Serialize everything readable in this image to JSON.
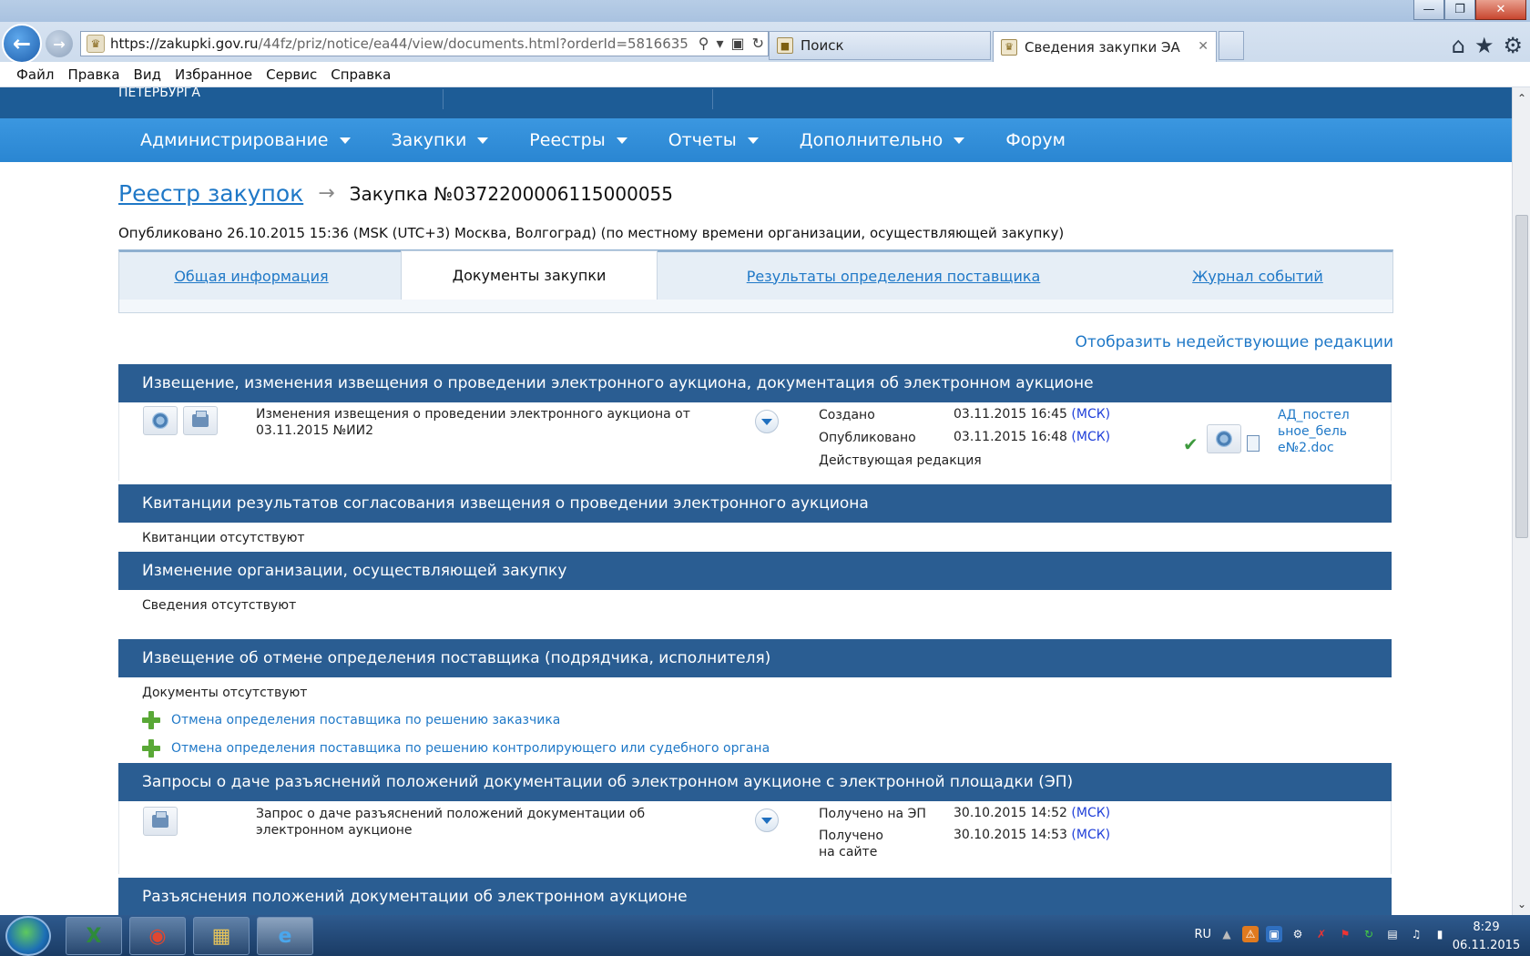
{
  "browser": {
    "url_host": "https://zakupki.gov.ru",
    "url_path": "/44fz/priz/notice/ea44/view/documents.html?orderId=5816635",
    "tabs": [
      {
        "label": "Поиск"
      },
      {
        "label": "Сведения закупки ЭА"
      }
    ],
    "menu": [
      "Файл",
      "Правка",
      "Вид",
      "Избранное",
      "Сервис",
      "Справка"
    ]
  },
  "site": {
    "org_line": "ПЕТЕРБУРГА",
    "nav": [
      {
        "label": "Администрирование",
        "has_dropdown": true
      },
      {
        "label": "Закупки",
        "has_dropdown": true
      },
      {
        "label": "Реестры",
        "has_dropdown": true
      },
      {
        "label": "Отчеты",
        "has_dropdown": true
      },
      {
        "label": "Дополнительно",
        "has_dropdown": true
      },
      {
        "label": "Форум",
        "has_dropdown": false
      }
    ]
  },
  "breadcrumb": {
    "registry_link": "Реестр закупок",
    "current": "Закупка №0372200006115000055"
  },
  "published_line": "Опубликовано 26.10.2015 15:36 (MSK (UTC+3) Москва, Волгоград) (по местному времени организации, осуществляющей закупку)",
  "tabs": [
    {
      "label": "Общая информация",
      "active": false
    },
    {
      "label": "Документы закупки",
      "active": true
    },
    {
      "label": "Результаты определения поставщика",
      "active": false
    },
    {
      "label": "Журнал событий",
      "active": false
    }
  ],
  "show_inactive_link": "Отобразить недействующие редакции",
  "sections": {
    "notice": {
      "title": "Извещение, изменения извещения о проведении электронного аукциона, документация об электронном аукционе",
      "doc_title": "Изменения извещения о проведении электронного аукциона от 03.11.2015 №ИИ2",
      "created_label": "Создано",
      "created_value": "03.11.2015 16:45",
      "published_label": "Опубликовано",
      "published_value": "03.11.2015 16:48",
      "tz": "(МСК)",
      "status": "Действующая редакция",
      "file_name": "АД_постельное_белье№2.doc"
    },
    "receipts": {
      "title": "Квитанции результатов согласования извещения о проведении электронного аукциона",
      "empty": "Квитанции отсутствуют"
    },
    "org_change": {
      "title": "Изменение организации, осуществляющей закупку",
      "empty": "Сведения отсутствуют"
    },
    "cancel": {
      "title": "Извещение об отмене определения поставщика (подрядчика, исполнителя)",
      "empty": "Документы отсутствуют",
      "links": [
        "Отмена определения поставщика по решению заказчика",
        "Отмена определения поставщика по решению контролирующего или судебного органа"
      ]
    },
    "requests": {
      "title": "Запросы о даче разъяснений положений документации об электронном аукционе с электронной площадки (ЭП)",
      "doc_title": "Запрос о даче разъяснений положений документации об электронном аукционе",
      "received_ep_label": "Получено на ЭП",
      "received_ep_value": "30.10.2015 14:52",
      "received_site_label": "Получено на сайте",
      "received_site_value": "30.10.2015 14:53",
      "tz": "(МСК)"
    },
    "clarifications": {
      "title": "Разъяснения положений документации об электронном аукционе"
    }
  },
  "taskbar": {
    "lang": "RU",
    "time": "8:29",
    "date": "06.11.2015"
  },
  "colors": {
    "nav_blue": "#2a86d2",
    "section_header": "#2a5d92",
    "link_blue": "#1f78c7",
    "msk_blue": "#1f3fd9"
  }
}
